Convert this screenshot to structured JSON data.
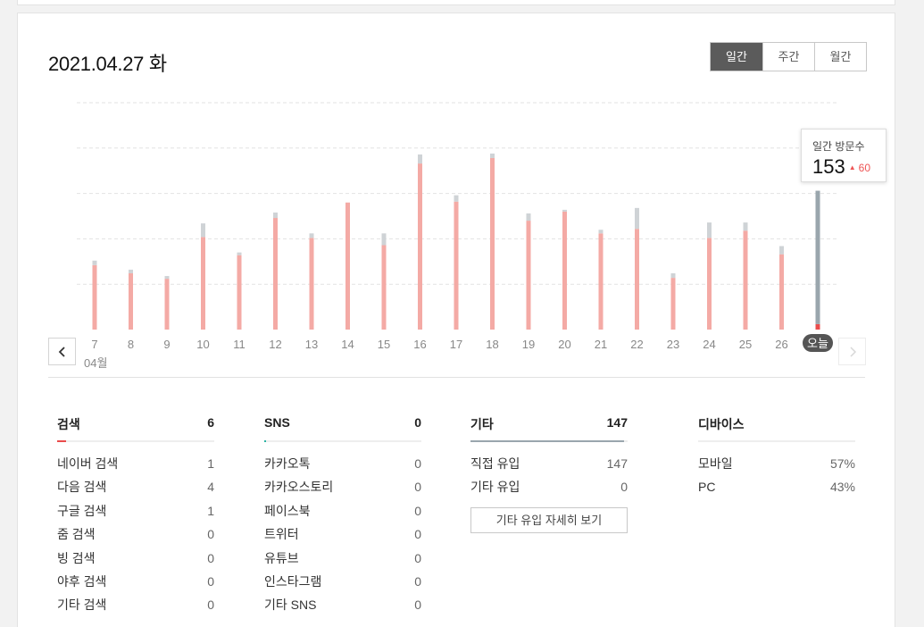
{
  "header": {
    "date": "2021.04.27 화",
    "tabs": [
      {
        "label": "일간",
        "active": true
      },
      {
        "label": "주간",
        "active": false
      },
      {
        "label": "월간",
        "active": false
      }
    ]
  },
  "tooltip": {
    "label": "일간 방문수",
    "value": "153",
    "delta": "60"
  },
  "chart_data": {
    "type": "bar",
    "stacked": true,
    "month_label": "04월",
    "categories": [
      "7",
      "8",
      "9",
      "10",
      "11",
      "12",
      "13",
      "14",
      "15",
      "16",
      "17",
      "18",
      "19",
      "20",
      "21",
      "22",
      "23",
      "24",
      "25",
      "26",
      "오늘"
    ],
    "series": [
      {
        "color": "#f4aaa5",
        "values": [
          71,
          62,
          56,
          102,
          82,
          123,
          101,
          140,
          93,
          183,
          141,
          189,
          120,
          130,
          106,
          111,
          57,
          101,
          109,
          83,
          6
        ]
      },
      {
        "color": "#cfd3d6",
        "values": [
          5,
          4,
          3,
          15,
          3,
          6,
          5,
          0,
          13,
          10,
          7,
          5,
          8,
          2,
          4,
          23,
          5,
          17,
          9,
          9,
          147
        ]
      }
    ],
    "ylim": [
      0,
      250
    ],
    "grid": true,
    "highlight": {
      "index": 20,
      "colors": [
        "#e94c4c",
        "#9aa6ad"
      ]
    }
  },
  "stats": {
    "search": {
      "title": "검색",
      "total": "6",
      "accent": "#e94c4c",
      "rows": [
        {
          "label": "네이버 검색",
          "value": "1"
        },
        {
          "label": "다음 검색",
          "value": "4"
        },
        {
          "label": "구글 검색",
          "value": "1"
        },
        {
          "label": "줌 검색",
          "value": "0"
        },
        {
          "label": "빙 검색",
          "value": "0"
        },
        {
          "label": "야후 검색",
          "value": "0"
        },
        {
          "label": "기타 검색",
          "value": "0"
        }
      ]
    },
    "sns": {
      "title": "SNS",
      "total": "0",
      "accent": "#2bb3a3",
      "rows": [
        {
          "label": "카카오톡",
          "value": "0"
        },
        {
          "label": "카카오스토리",
          "value": "0"
        },
        {
          "label": "페이스북",
          "value": "0"
        },
        {
          "label": "트위터",
          "value": "0"
        },
        {
          "label": "유튜브",
          "value": "0"
        },
        {
          "label": "인스타그램",
          "value": "0"
        },
        {
          "label": "기타 SNS",
          "value": "0"
        }
      ]
    },
    "etc": {
      "title": "기타",
      "total": "147",
      "accent": "#9aa6ad",
      "rows": [
        {
          "label": "직접 유입",
          "value": "147"
        },
        {
          "label": "기타 유입",
          "value": "0"
        }
      ],
      "button": "기타 유입 자세히 보기"
    },
    "device": {
      "title": "디바이스",
      "rows": [
        {
          "label": "모바일",
          "value": "57%"
        },
        {
          "label": "PC",
          "value": "43%"
        }
      ]
    }
  }
}
